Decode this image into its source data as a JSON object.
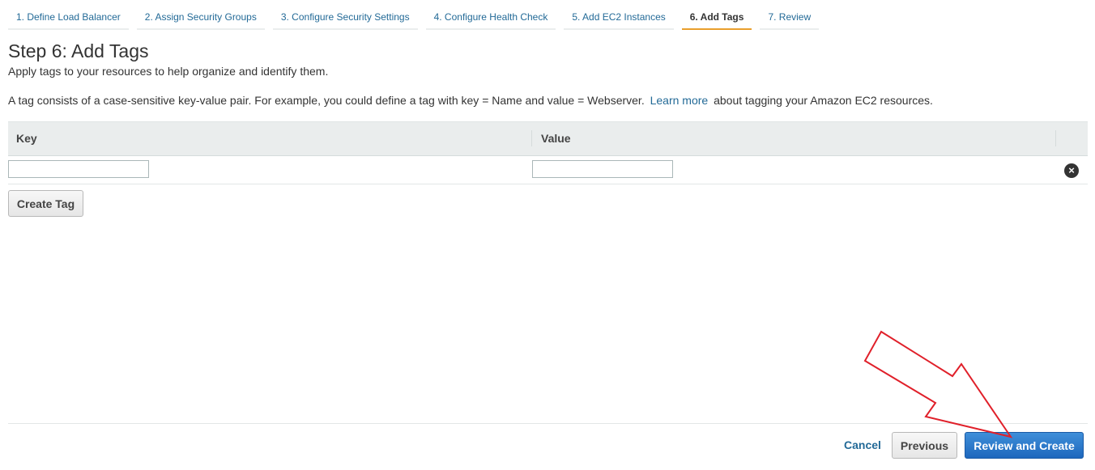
{
  "wizard": {
    "tabs": [
      {
        "label": "1. Define Load Balancer"
      },
      {
        "label": "2. Assign Security Groups"
      },
      {
        "label": "3. Configure Security Settings"
      },
      {
        "label": "4. Configure Health Check"
      },
      {
        "label": "5. Add EC2 Instances"
      },
      {
        "label": "6. Add Tags"
      },
      {
        "label": "7. Review"
      }
    ],
    "active_tab": "6. Add Tags"
  },
  "page": {
    "title": "Step 6: Add Tags",
    "subtitle": "Apply tags to your resources to help organize and identify them.",
    "description_before": "A tag consists of a case-sensitive key-value pair. For example, you could define a tag with key = Name and value = Webserver.",
    "learn_more": "Learn more",
    "description_after": "about tagging your Amazon EC2 resources."
  },
  "tags_table": {
    "key_header": "Key",
    "value_header": "Value",
    "rows": [
      {
        "key": "",
        "value": ""
      }
    ],
    "create_tag_label": "Create Tag"
  },
  "footer": {
    "cancel_label": "Cancel",
    "previous_label": "Previous",
    "review_label": "Review and Create"
  },
  "colors": {
    "link": "#236a97",
    "active_tab_underline": "#e99f2c",
    "primary_button": "#1d67bd",
    "annotation_arrow": "#e0202a"
  }
}
